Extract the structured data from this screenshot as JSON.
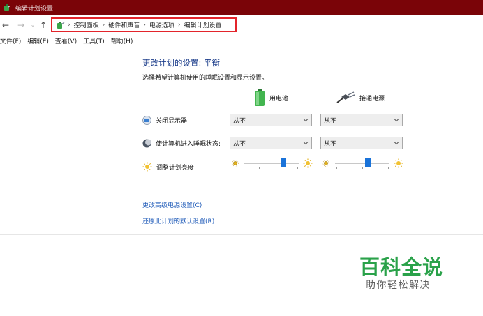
{
  "window": {
    "title": "编辑计划设置"
  },
  "nav": {
    "back": "←",
    "forward": "→",
    "recent": "⌄",
    "up": "↑"
  },
  "breadcrumb": {
    "items": [
      "控制面板",
      "硬件和声音",
      "电源选项",
      "编辑计划设置"
    ],
    "separator": "›"
  },
  "menubar": {
    "items": [
      "文件(F)",
      "编辑(E)",
      "查看(V)",
      "工具(T)",
      "帮助(H)"
    ]
  },
  "main": {
    "heading": "更改计划的设置: 平衡",
    "subheading": "选择希望计算机使用的睡眠设置和显示设置。",
    "columns": {
      "battery": "用电池",
      "plugged": "接通电源"
    },
    "rows": {
      "display": {
        "label": "关闭显示器:",
        "battery": "从不",
        "plugged": "从不"
      },
      "sleep": {
        "label": "使计算机进入睡眠状态:",
        "battery": "从不",
        "plugged": "从不"
      },
      "brightness": {
        "label": "调整计划亮度:",
        "battery_level_pct": 72,
        "plugged_level_pct": 60
      }
    },
    "links": {
      "advanced": "更改高级电源设置(C)",
      "restore": "还原此计划的默认设置(R)"
    }
  },
  "watermark": {
    "big": "百科全说",
    "small": "助你轻松解决"
  },
  "colors": {
    "titlebar": "#7a0408",
    "accent": "#1a73d9",
    "link": "#1e5ab8",
    "heading": "#1e3f8c",
    "highlight": "#e3242b",
    "watermark": "#2aa24a"
  }
}
